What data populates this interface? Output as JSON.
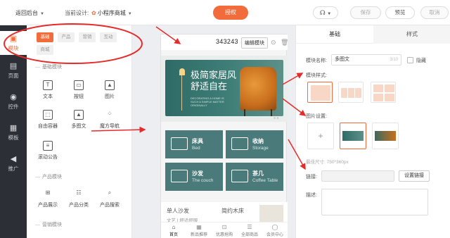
{
  "topbar": {
    "back_label": "返回后台",
    "current_design_label": "当前设计:",
    "app_name": "小程序商城",
    "authorize_label": "授权",
    "save_label": "保存",
    "preview_label": "预览",
    "cancel_label": "取消"
  },
  "rail": {
    "items": [
      {
        "label": "模块",
        "icon": "module-icon"
      },
      {
        "label": "页面",
        "icon": "page-icon"
      },
      {
        "label": "控件",
        "icon": "control-icon"
      },
      {
        "label": "模板",
        "icon": "template-icon"
      },
      {
        "label": "推广",
        "icon": "promotion-icon"
      }
    ]
  },
  "panel": {
    "category_tabs": [
      "基础",
      "产品",
      "营销",
      "互动",
      "商城"
    ],
    "sections": [
      {
        "title": "基础模块",
        "items": [
          "文本",
          "按钮",
          "图片",
          "自由容器",
          "多图文",
          "魔方导航",
          "滚动公告"
        ]
      },
      {
        "title": "产品模块",
        "items": [
          "产品展示",
          "产品分类",
          "产品搜索"
        ]
      },
      {
        "title": "营销模块",
        "items": []
      }
    ]
  },
  "canvas": {
    "module_id": "343243",
    "edit_module_label": "编辑模块",
    "banner": {
      "title_line1": "极简家居风",
      "title_line2": "舒适自在",
      "subtitle": "DECORATING A HOME IS SUCH A SIMPLE MATTER ORIGINALLY"
    },
    "categories": [
      {
        "cn": "床具",
        "en": "Bed"
      },
      {
        "cn": "收纳",
        "en": "Storage"
      },
      {
        "cn": "沙发",
        "en": "The couch"
      },
      {
        "cn": "茶几",
        "en": "Coffee Table"
      }
    ],
    "cards": [
      {
        "title": "单人沙发",
        "sub": "文艺 | 舒适舒服"
      },
      {
        "title": "简约木床",
        "sub": ""
      }
    ],
    "tabbar": [
      {
        "label": "首页",
        "icon": "home-icon"
      },
      {
        "label": "新品推荐",
        "icon": "grid-icon"
      },
      {
        "label": "优惠抢购",
        "icon": "cart-icon"
      },
      {
        "label": "全部商品",
        "icon": "list-icon"
      },
      {
        "label": "会员中心",
        "icon": "user-icon"
      }
    ]
  },
  "settings": {
    "tabs": [
      "基础",
      "样式"
    ],
    "module_name_label": "模块名称:",
    "module_name_value": "多图文",
    "module_name_count": "3/10",
    "hide_label": "隐藏",
    "module_style_label": "模块样式:",
    "image_setting_label": "图片设置:",
    "image_size_hint": "最佳尺寸: 750*360px",
    "link_label": "链接:",
    "set_link_label": "设置链接",
    "description_label": "描述:"
  },
  "colors": {
    "accent": "#f26b3a",
    "annotation": "#e62b2b",
    "banner_teal": "#3f7f78",
    "category_teal": "#4a7a79"
  }
}
